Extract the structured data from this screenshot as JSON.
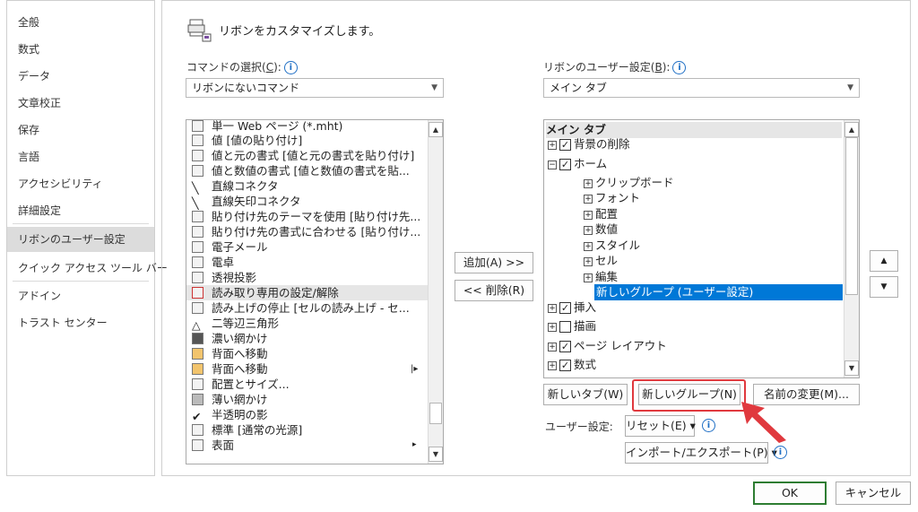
{
  "nav": {
    "items": [
      "全般",
      "数式",
      "データ",
      "文章校正",
      "保存",
      "言語",
      "アクセシビリティ",
      "詳細設定",
      "リボンのユーザー設定",
      "クイック アクセス ツール バー",
      "アドイン",
      "トラスト センター"
    ],
    "selected_index": 8
  },
  "heading": "リボンをカスタマイズします。",
  "left_panel": {
    "label": "コマンドの選択(",
    "label_key": "C",
    "label_end": "):",
    "dropdown_value": "リボンにないコマンド",
    "commands": [
      "単一 Web ページ (*.mht)",
      "値 [値の貼り付け]",
      "値と元の書式 [値と元の書式を貼り付け]",
      "値と数値の書式 [値と数値の書式を貼...",
      "直線コネクタ",
      "直線矢印コネクタ",
      "貼り付け先のテーマを使用 [貼り付け先...",
      "貼り付け先の書式に合わせる [貼り付け...",
      "電子メール",
      "電卓",
      "透視投影",
      "読み取り専用の設定/解除",
      "読み上げの停止 [セルの読み上げ - セ...",
      "二等辺三角形",
      "濃い網かけ",
      "背面へ移動",
      "背面へ移動",
      "配置とサイズ...",
      "薄い網かけ",
      "半透明の影",
      "標準 [通常の光源]",
      "表面"
    ],
    "highlighted_index": 11
  },
  "middle_buttons": {
    "add": "追加(A) >>",
    "remove": "<< 削除(R)"
  },
  "right_panel": {
    "label": "リボンのユーザー設定(",
    "label_key": "B",
    "label_end": "):",
    "dropdown_value": "メイン タブ",
    "tree_header": "メイン タブ",
    "tree": [
      {
        "expander": "⊞",
        "checked": true,
        "label": "背景の削除",
        "level": 0
      },
      {
        "expander": "⊟",
        "checked": true,
        "label": "ホーム",
        "level": 0
      },
      {
        "expander": "⊞",
        "label": "クリップボード",
        "level": 1
      },
      {
        "expander": "⊞",
        "label": "フォント",
        "level": 1
      },
      {
        "expander": "⊞",
        "label": "配置",
        "level": 1
      },
      {
        "expander": "⊞",
        "label": "数値",
        "level": 1
      },
      {
        "expander": "⊞",
        "label": "スタイル",
        "level": 1
      },
      {
        "expander": "⊞",
        "label": "セル",
        "level": 1
      },
      {
        "expander": "⊞",
        "label": "編集",
        "level": 1
      },
      {
        "label": "新しいグループ (ユーザー設定)",
        "level": 2,
        "selected": true
      },
      {
        "expander": "⊞",
        "checked": true,
        "label": "挿入",
        "level": 0
      },
      {
        "expander": "⊞",
        "checked": false,
        "label": "描画",
        "level": 0
      },
      {
        "expander": "⊞",
        "checked": true,
        "label": "ページ レイアウト",
        "level": 0
      },
      {
        "expander": "⊞",
        "checked": true,
        "label": "数式",
        "level": 0
      }
    ],
    "new_tab": "新しいタブ(W)",
    "new_group": "新しいグループ(N)",
    "rename": "名前の変更(M)...",
    "user_settings_label": "ユーザー設定:",
    "reset": "リセット(E) ▾",
    "import_export": "インポート/エクスポート(P) ▾"
  },
  "footer": {
    "ok": "OK",
    "cancel": "キャンセル"
  },
  "colors": {
    "selection": "#0078d7",
    "callout_red": "#e0393e",
    "ok_border": "#2e7d32",
    "info_blue": "#1f6fc5"
  }
}
